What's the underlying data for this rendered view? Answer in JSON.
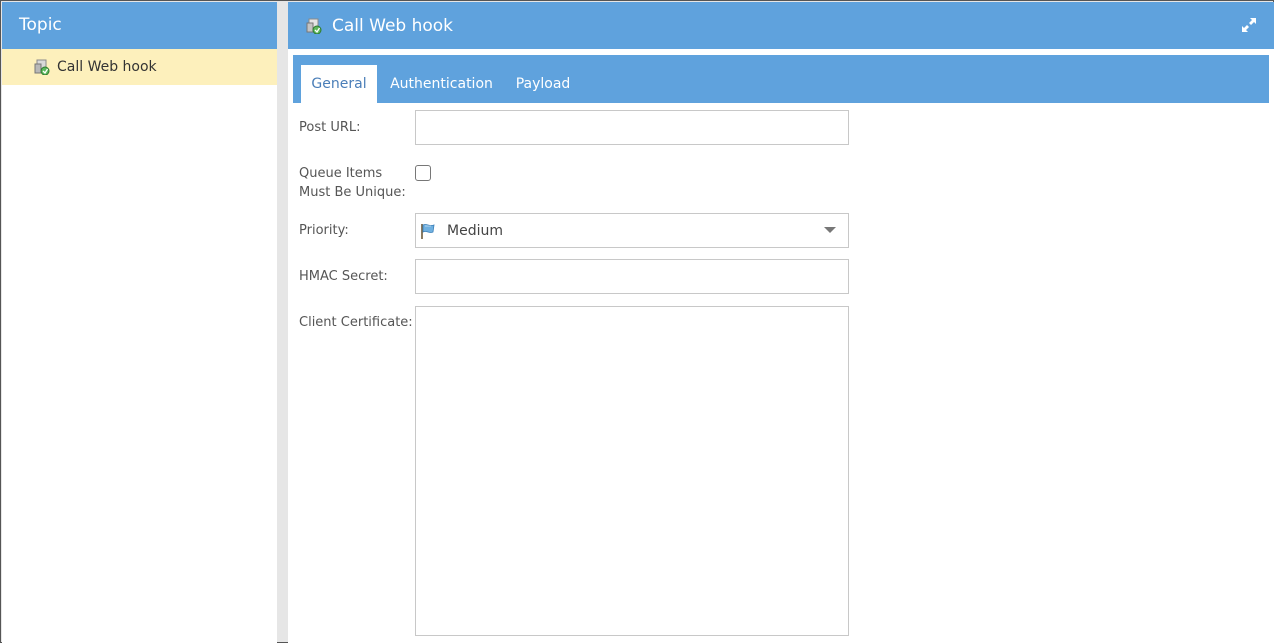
{
  "left_panel": {
    "title": "Topic",
    "items": [
      {
        "label": "Call Web hook",
        "icon": "web-hook-icon"
      }
    ]
  },
  "right_panel": {
    "title": "Call Web hook",
    "icon": "web-hook-icon",
    "maximize_icon": "expand-icon",
    "tabs": [
      {
        "label": "General",
        "active": true
      },
      {
        "label": "Authentication",
        "active": false
      },
      {
        "label": "Payload",
        "active": false
      }
    ],
    "form": {
      "post_url": {
        "label": "Post URL:",
        "value": ""
      },
      "queue_unique": {
        "label_line1": "Queue Items",
        "label_line2": "Must Be Unique:",
        "checked": false
      },
      "priority": {
        "label": "Priority:",
        "value": "Medium",
        "icon": "flag-icon"
      },
      "hmac_secret": {
        "label": "HMAC Secret:",
        "value": ""
      },
      "client_certificate": {
        "label": "Client Certificate:",
        "value": ""
      }
    }
  },
  "colors": {
    "header_blue": "#5fa2dd",
    "selected_item": "#fdf0bc",
    "active_tab_text": "#4a7eb8"
  }
}
